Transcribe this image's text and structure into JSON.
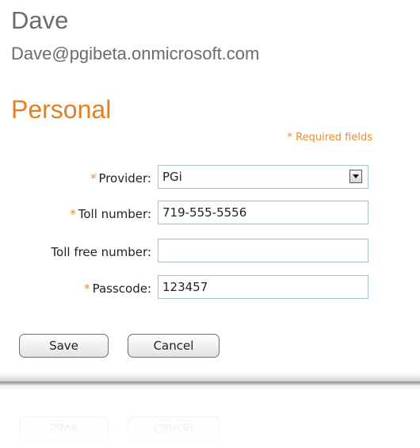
{
  "user": {
    "name": "Dave",
    "email": "Dave@pgibeta.onmicrosoft.com"
  },
  "section": {
    "title": "Personal",
    "required_note": "* Required fields"
  },
  "form": {
    "provider": {
      "label": "Provider:",
      "required": true,
      "value": "PGi"
    },
    "toll_number": {
      "label": "Toll number:",
      "required": true,
      "value": "719-555-5556"
    },
    "toll_free_number": {
      "label": "Toll free number:",
      "required": false,
      "value": ""
    },
    "passcode": {
      "label": "Passcode:",
      "required": true,
      "value": "123457"
    }
  },
  "actions": {
    "save_label": "Save",
    "cancel_label": "Cancel"
  },
  "colors": {
    "accent": "#e67e22",
    "required": "#f08a2c",
    "field_border": "#a7bcd6",
    "heading_gray": "#6b6b6b"
  },
  "icons": {
    "dropdown": "chevron-down-icon"
  }
}
